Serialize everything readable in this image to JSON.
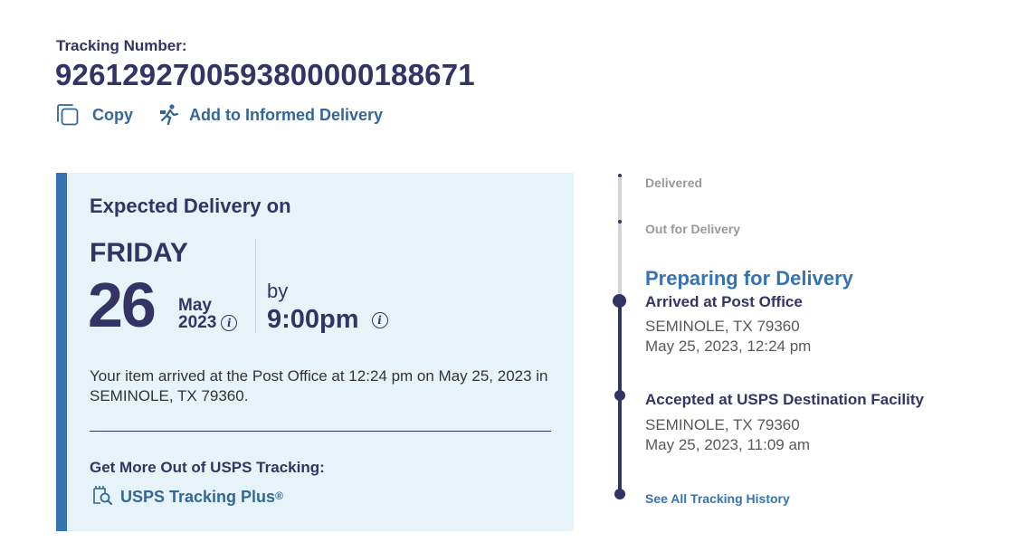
{
  "tracking": {
    "label": "Tracking Number:",
    "number": "9261292700593800000188671",
    "copy_label": "Copy",
    "informed_label": "Add to Informed Delivery"
  },
  "expected": {
    "title": "Expected Delivery on",
    "weekday": "FRIDAY",
    "day": "26",
    "month": "May",
    "year": "2023",
    "by_label": "by",
    "time": "9:00pm",
    "info_glyph": "i",
    "message": "Your item arrived at the Post Office at 12:24 pm on May 25, 2023 in SEMINOLE, TX 79360.",
    "more_title": "Get More Out of USPS Tracking:",
    "plus_label": "USPS Tracking Plus",
    "plus_mark": "®"
  },
  "timeline": {
    "delivered": "Delivered",
    "out_for_delivery": "Out for Delivery",
    "current_status": "Preparing for Delivery",
    "events": [
      {
        "title": "Arrived at Post Office",
        "location": "SEMINOLE, TX 79360",
        "datetime": "May 25, 2023, 12:24 pm"
      },
      {
        "title": "Accepted at USPS Destination Facility",
        "location": "SEMINOLE, TX 79360",
        "datetime": "May 25, 2023, 11:09 am"
      }
    ],
    "history_label": "See All Tracking History"
  },
  "colors": {
    "navy": "#333366",
    "link_blue": "#336699",
    "accent_blue": "#3573b1",
    "card_bg": "#e6f4f9",
    "muted_grey": "#999999"
  },
  "icons": {
    "copy": "copy-icon",
    "informed": "informed-delivery-icon",
    "info": "info-icon",
    "tracking_plus": "tracking-plus-icon"
  }
}
